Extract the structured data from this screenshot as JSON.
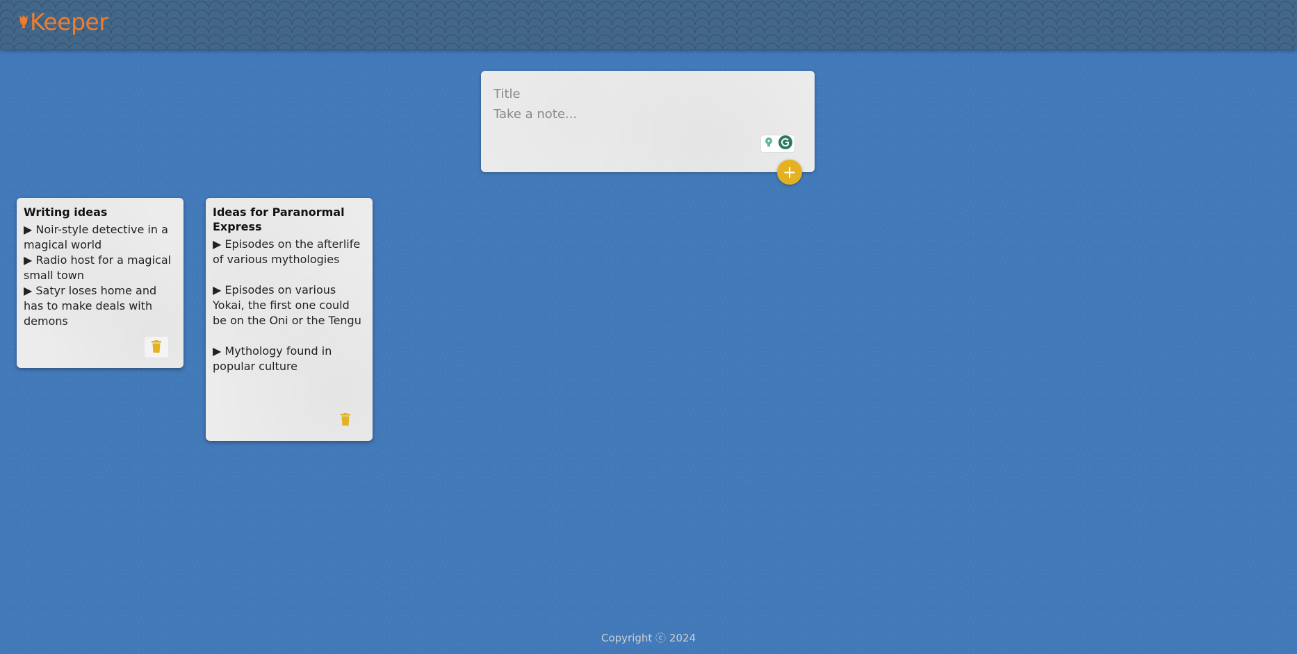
{
  "header": {
    "logo_text": "Keeper",
    "logo_icon": "lightbulb-icon",
    "logo_color": "#f07d2c"
  },
  "composer": {
    "title_placeholder": "Title",
    "body_placeholder": "Take a note...",
    "add_label": "+",
    "add_icon": "plus-icon",
    "accent_color": "#e4b221",
    "extension_icons": [
      "lightbulb-icon",
      "grammarly-icon"
    ]
  },
  "notes": [
    {
      "title": "Writing ideas",
      "content": "▶ Noir-style detective in a magical world\n▶ Radio host for a magical small town\n▶ Satyr loses home and has to make deals with demons",
      "delete_icon": "trash-icon"
    },
    {
      "title": "Ideas for Paranormal Express",
      "content": "▶ Episodes on the afterlife of various mythologies\n\n▶ Episodes on various Yokai, the first one could be on the Oni or the Tengu\n\n▶ Mythology found in popular culture",
      "delete_icon": "trash-icon"
    }
  ],
  "footer": {
    "copyright": "Copyright ⓒ 2024"
  },
  "colors": {
    "background": "#4279b9",
    "header": "#436789",
    "note": "#ececec"
  }
}
